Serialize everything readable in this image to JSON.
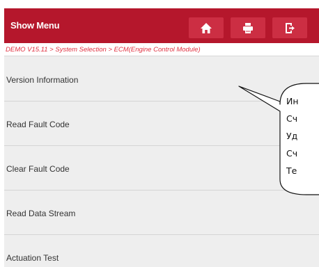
{
  "header": {
    "title": "Show Menu",
    "home_icon": "home-icon",
    "print_icon": "print-icon",
    "exit_icon": "exit-icon"
  },
  "breadcrumb": "DEMO V15.11 > System Selection > ECM(Engine Control Module)",
  "menu": {
    "items": [
      {
        "label": "Version Information"
      },
      {
        "label": "Read Fault Code"
      },
      {
        "label": "Clear Fault Code"
      },
      {
        "label": "Read Data Stream"
      },
      {
        "label": "Actuation Test"
      }
    ]
  },
  "callout": {
    "lines": [
      "Ин",
      "Сч",
      "Уд",
      "Сч",
      "Те"
    ]
  },
  "colors": {
    "header_bg": "#b5172c",
    "breadcrumb_text": "#e03040",
    "menu_bg": "#eeeeee"
  }
}
